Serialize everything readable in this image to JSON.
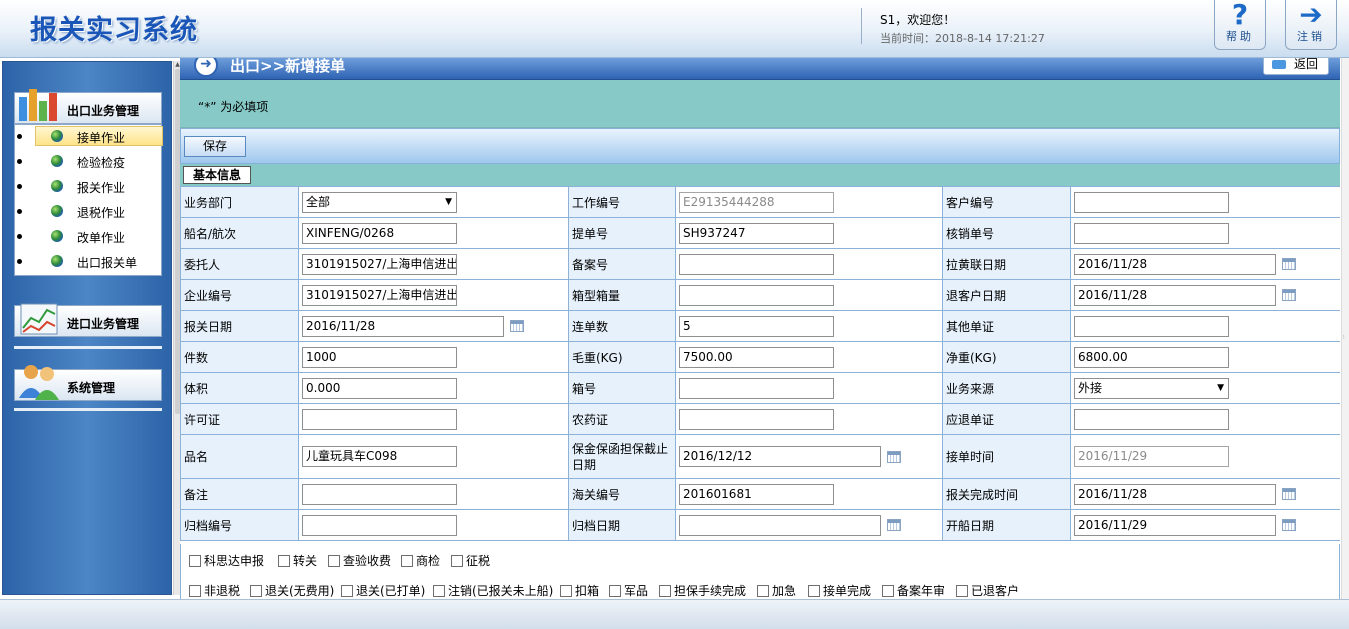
{
  "header": {
    "app_title": "报关实习系统",
    "welcome": "S1，欢迎您！",
    "time_label": "当前时间：",
    "time_value": "2018-8-14 17:21:27",
    "help_label": "帮助",
    "logout_label": "注销"
  },
  "sidebar": {
    "export_header": "出口业务管理",
    "import_header": "进口业务管理",
    "system_header": "系统管理",
    "items": [
      {
        "label": "接单作业",
        "active": true
      },
      {
        "label": "检验检疫"
      },
      {
        "label": "报关作业"
      },
      {
        "label": "退税作业"
      },
      {
        "label": "改单作业"
      },
      {
        "label": "出口报关单"
      }
    ]
  },
  "main": {
    "breadcrumb": "出口>>新增接单",
    "back_label": "返回",
    "required_note": "“*” 为必填项",
    "save_label": "保存",
    "section_tab": "基本信息"
  },
  "form": {
    "labels": {
      "dept": "业务部门",
      "work_no": "工作编号",
      "customer_no": "客户编号",
      "vessel": "船名/航次",
      "bl_no": "提单号",
      "verify_no": "核销单号",
      "consignor": "委托人",
      "record_no": "备案号",
      "yellow_date": "拉黄联日期",
      "company_no": "企业编号",
      "container_type": "箱型箱量",
      "return_customer_date": "退客户日期",
      "declare_date": "报关日期",
      "bill_count": "连单数",
      "other_doc": "其他单证",
      "pieces": "件数",
      "gross_weight": "毛重(KG)",
      "net_weight": "净重(KG)",
      "volume": "体积",
      "container_no": "箱号",
      "source": "业务来源",
      "license": "许可证",
      "pesticide": "农药证",
      "refund_doc": "应退单证",
      "product": "品名",
      "guarantee_date": "保金保函担保截止日期",
      "accept_time": "接单时间",
      "remark": "备注",
      "customs_no": "海关编号",
      "declare_done_time": "报关完成时间",
      "archive_no": "归档编号",
      "archive_date": "归档日期",
      "sail_date": "开船日期"
    },
    "values": {
      "dept": "全部",
      "work_no": "E29135444288",
      "customer_no": "",
      "vessel": "XINFENG/0268",
      "bl_no": "SH937247",
      "verify_no": "",
      "consignor": "3101915027/上海申信进出",
      "record_no": "",
      "yellow_date": "2016/11/28",
      "company_no": "3101915027/上海申信进出",
      "container_type": "",
      "return_customer_date": "2016/11/28",
      "declare_date": "2016/11/28",
      "bill_count": "5",
      "other_doc": "",
      "pieces": "1000",
      "gross_weight": "7500.00",
      "net_weight": "6800.00",
      "volume": "0.000",
      "container_no": "",
      "source": "外接",
      "license": "",
      "pesticide": "",
      "refund_doc": "",
      "product": "儿童玩具车C098",
      "guarantee_date": "2016/12/12",
      "accept_time": "2016/11/29",
      "remark": "",
      "customs_no": "201601681",
      "declare_done_time": "2016/11/28",
      "archive_no": "",
      "archive_date": "",
      "sail_date": "2016/11/29"
    }
  },
  "checks_row1": [
    "科思达申报",
    "转关",
    "查验收费",
    "商检",
    "征税"
  ],
  "checks_row2": [
    "非退税",
    "退关(无费用)",
    "退关(已打单)",
    "注销(已报关未上船)",
    "扣箱",
    "军品",
    "担保手续完成",
    "加急",
    "接单完成",
    "备案年审",
    "已退客户"
  ]
}
